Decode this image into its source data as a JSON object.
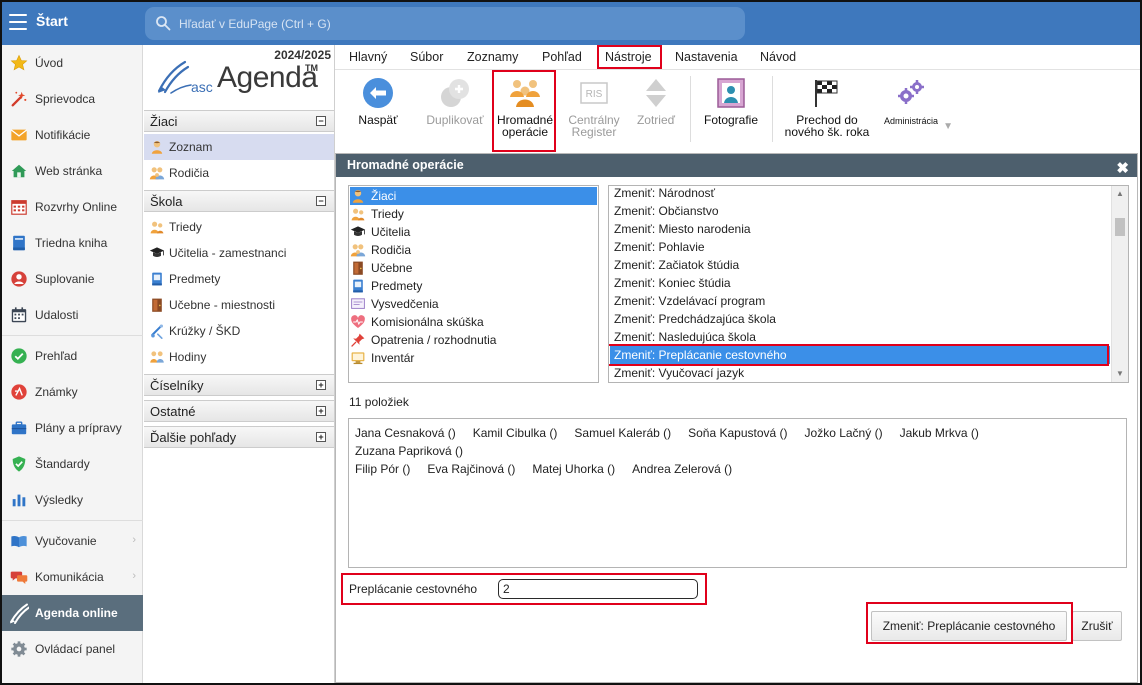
{
  "app": {
    "start_label": "Štart",
    "search_placeholder": "Hľadať v EduPage (Ctrl + G)"
  },
  "colors": {
    "header_blue": "#3e78bd",
    "selection_blue": "#3b8fe8",
    "highlight_red": "#e0001b",
    "active_sidebar": "#5a6e7d"
  },
  "sidebar": {
    "items": [
      {
        "label": "Úvod",
        "icon": "star-icon"
      },
      {
        "label": "Sprievodca",
        "icon": "magic-wand-icon"
      },
      {
        "label": "Notifikácie",
        "icon": "envelope-icon"
      },
      {
        "label": "Web stránka",
        "icon": "house-icon"
      },
      {
        "label": "Rozvrhy Online",
        "icon": "timetable-icon"
      },
      {
        "label": "Triedna kniha",
        "icon": "class-book-icon"
      },
      {
        "label": "Suplovanie",
        "icon": "substitute-icon"
      },
      {
        "label": "Udalosti",
        "icon": "calendar-icon"
      },
      {
        "divider": true
      },
      {
        "label": "Prehľad",
        "icon": "overview-check-icon"
      },
      {
        "label": "Známky",
        "icon": "grades-icon"
      },
      {
        "label": "Plány a prípravy",
        "icon": "briefcase-icon"
      },
      {
        "label": "Štandardy",
        "icon": "shield-check-icon"
      },
      {
        "label": "Výsledky",
        "icon": "bar-chart-icon"
      },
      {
        "divider": true
      },
      {
        "label": "Vyučovanie",
        "icon": "open-book-icon",
        "chevron": true
      },
      {
        "label": "Komunikácia",
        "icon": "chat-icon",
        "chevron": true
      },
      {
        "label": "Agenda online",
        "icon": "pen-icon",
        "active": true
      },
      {
        "label": "Ovládací panel",
        "icon": "gear-icon"
      }
    ]
  },
  "panel": {
    "year": "2024/2025",
    "logo_prefix": "asc",
    "logo_name": "Agenda",
    "logo_tm": "TM",
    "groups": [
      {
        "title": "Žiaci",
        "expanded": true,
        "children": [
          {
            "label": "Zoznam",
            "icon": "student-icon",
            "selected": true
          },
          {
            "label": "Rodičia",
            "icon": "parents-icon"
          }
        ]
      },
      {
        "title": "Škola",
        "expanded": true,
        "children": [
          {
            "label": "Triedy",
            "icon": "class-icon"
          },
          {
            "label": "Učitelia - zamestnanci",
            "icon": "teacher-icon"
          },
          {
            "label": "Predmety",
            "icon": "subject-icon"
          },
          {
            "label": "Učebne - miestnosti",
            "icon": "door-icon"
          },
          {
            "label": "Krúžky / ŠKD",
            "icon": "clubs-icon"
          },
          {
            "label": "Hodiny",
            "icon": "lessons-icon"
          }
        ]
      },
      {
        "title": "Číselníky",
        "expanded": false,
        "children": []
      },
      {
        "title": "Ostatné",
        "expanded": false,
        "children": []
      },
      {
        "title": "Ďalšie pohľady",
        "expanded": false,
        "children": []
      }
    ]
  },
  "menu": {
    "tabs": [
      {
        "label": "Hlavný"
      },
      {
        "label": "Súbor"
      },
      {
        "label": "Zoznamy"
      },
      {
        "label": "Pohľad"
      },
      {
        "label": "Nástroje",
        "highlighted": true
      },
      {
        "label": "Nastavenia"
      },
      {
        "label": "Návod"
      }
    ]
  },
  "ribbon": {
    "items": [
      {
        "label": "Naspäť",
        "icon": "back-arrow-icon"
      },
      {
        "label": "Duplikovať",
        "icon": "duplicate-icon",
        "disabled": true
      },
      {
        "label": "Hromadné\noperácie",
        "icon": "bulk-operations-icon",
        "highlighted": true
      },
      {
        "label": "Centrálny\nRegister",
        "icon": "ris-register-icon",
        "disabled": true
      },
      {
        "label": "Zotrieď",
        "icon": "sort-icon",
        "disabled": true
      },
      {
        "separator": true
      },
      {
        "label": "Fotografie",
        "icon": "photo-frame-icon"
      },
      {
        "separator": true
      },
      {
        "label": "Prechod do\nnového šk. roka",
        "icon": "checkered-flag-icon"
      },
      {
        "label": "Administrácia",
        "icon": "admin-gears-icon",
        "small": true,
        "dropdown": true
      }
    ]
  },
  "dialog": {
    "title": "Hromadné operácie",
    "close_icon": "close-icon",
    "types": [
      {
        "label": "Žiaci",
        "icon": "student-icon"
      },
      {
        "label": "Triedy",
        "icon": "class-icon"
      },
      {
        "label": "Učitelia",
        "icon": "teacher-icon"
      },
      {
        "label": "Rodičia",
        "icon": "parents-icon"
      },
      {
        "label": "Učebne",
        "icon": "door-icon"
      },
      {
        "label": "Predmety",
        "icon": "subject-icon"
      },
      {
        "label": "Vysvedčenia",
        "icon": "certificate-icon"
      },
      {
        "label": "Komisionálna skúška",
        "icon": "exam-icon"
      },
      {
        "label": "Opatrenia / rozhodnutia",
        "icon": "pin-icon"
      },
      {
        "label": "Inventár",
        "icon": "computer-icon"
      }
    ],
    "selected_type": 0,
    "operations": [
      "Zmeniť: Národnosť",
      "Zmeniť: Občianstvo",
      "Zmeniť: Miesto narodenia",
      "Zmeniť: Pohlavie",
      "Zmeniť: Začiatok štúdia",
      "Zmeniť: Koniec štúdia",
      "Zmeniť: Vzdelávací program",
      "Zmeniť: Predchádzajúca škola",
      "Zmeniť: Nasledujúca škola",
      "Zmeniť: Preplácanie cestovného",
      "Zmeniť: Vyučovací jazyk"
    ],
    "selected_operation": 9,
    "count_text": "11 položiek",
    "students": [
      "Jana Cesnaková ()",
      "Kamil Cibulka ()",
      "Samuel Kaleráb ()",
      "Soňa Kapustová ()",
      "Jožko Lačný ()",
      "Jakub Mrkva ()",
      "Zuzana Papriková ()",
      "Filip Pór ()",
      "Eva Rajčinová ()",
      "Matej Uhorka ()",
      "Andrea Zelerová ()"
    ],
    "field_label": "Preplácanie cestovného",
    "field_value": "2",
    "apply_button": "Zmeniť: Preplácanie cestovného",
    "cancel_button": "Zrušiť"
  }
}
